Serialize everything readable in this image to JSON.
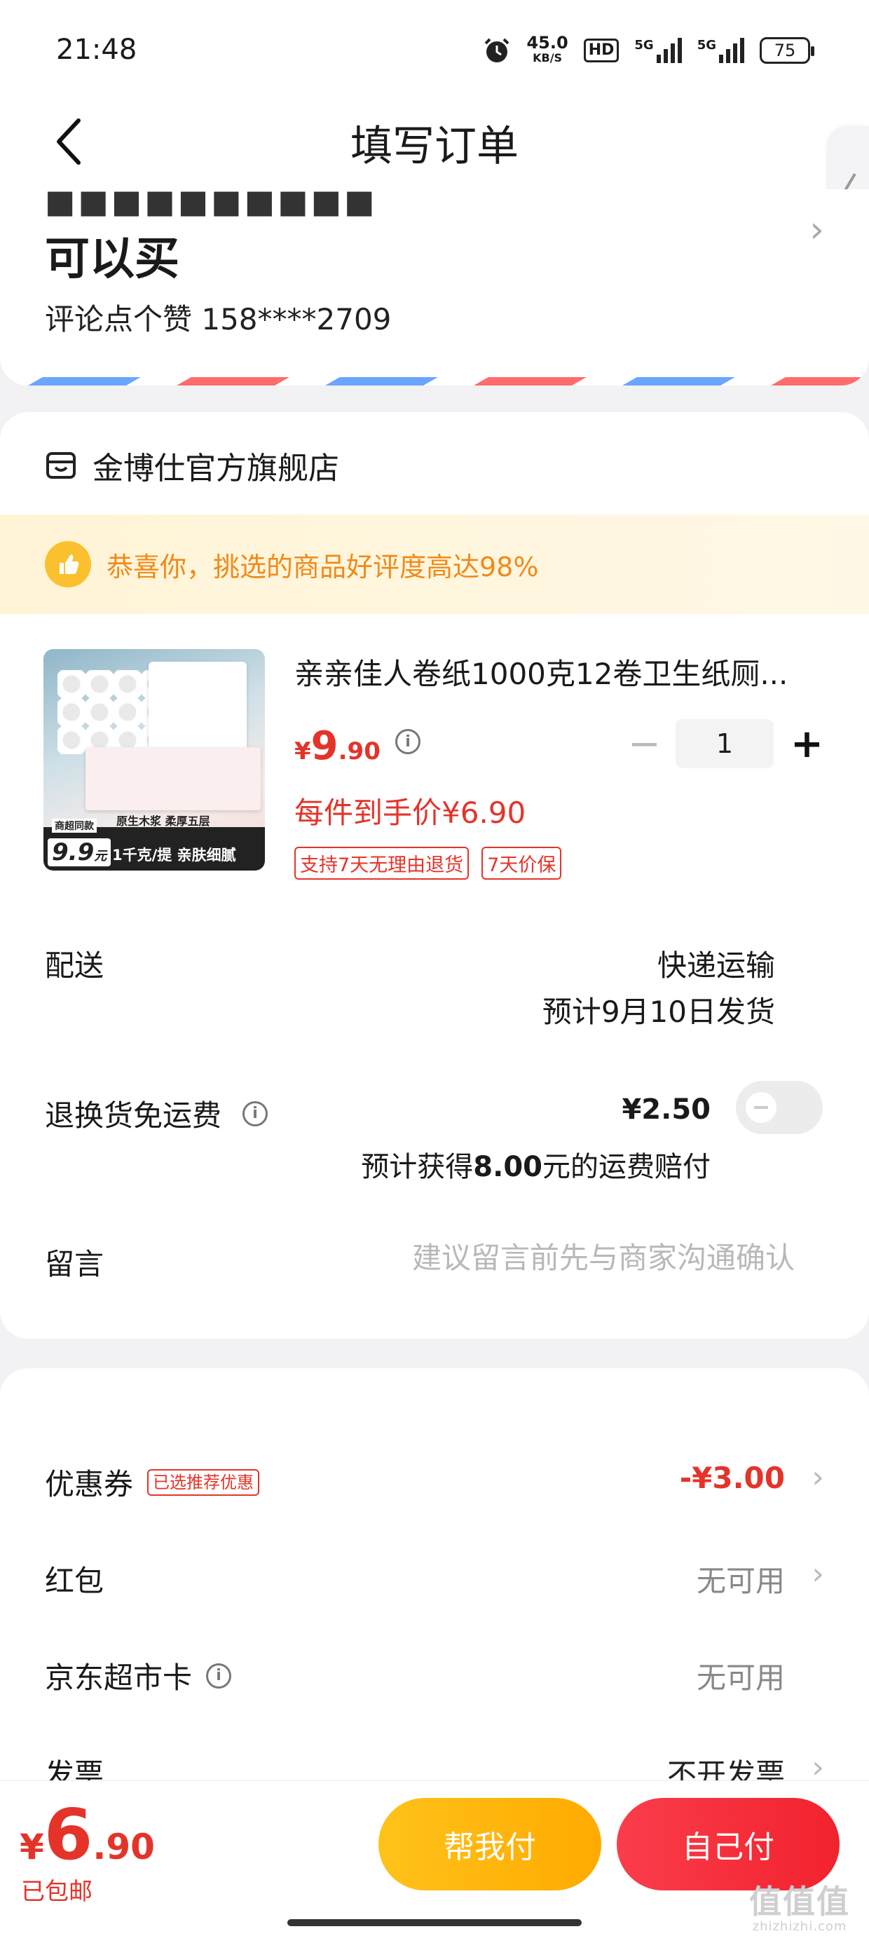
{
  "status_bar": {
    "time": "21:48",
    "net_speed": "45.0",
    "net_unit": "KB/S",
    "hd": "HD",
    "sim1": "5G",
    "sim2": "5G",
    "battery": "75"
  },
  "nav": {
    "title": "填写订单"
  },
  "address": {
    "partial_line": "■■■■■■■■■■",
    "main": "可以买",
    "contact": "评论点个赞  158****2709"
  },
  "store": {
    "name": "金博仕官方旗舰店",
    "banner_text": "恭喜你，挑选的商品好评度高达98%"
  },
  "product": {
    "title": "亲亲佳人卷纸1000克12卷卫生纸厕...",
    "price_symbol": "¥",
    "price_int": "9",
    "price_dec": ".90",
    "quantity": "1",
    "final_price": "每件到手价¥6.90",
    "tags": [
      "支持7天无理由退货",
      "7天价保"
    ],
    "image_price": "9.9",
    "image_price_unit": "元",
    "image_spec": "1千克/提  亲肤细腻",
    "image_spec_top": "原生木浆 柔厚五层",
    "image_tag": "商超同款"
  },
  "delivery": {
    "label": "配送",
    "method": "快递运输",
    "date": "预计9月10日发货"
  },
  "return_shipping": {
    "label": "退换货免运费",
    "price": "¥2.50",
    "compensation_pre": "预计获得",
    "compensation_amount": "8.00",
    "compensation_post": "元的运费赔付",
    "enabled": false
  },
  "message": {
    "label": "留言",
    "placeholder": "建议留言前先与商家沟通确认",
    "value": ""
  },
  "payment_rows": [
    {
      "label": "优惠券",
      "badge": "已选推荐优惠",
      "value": "-¥3.00"
    },
    {
      "label": "红包",
      "value": "无可用"
    },
    {
      "label": "京东超市卡",
      "value": "无可用"
    },
    {
      "label": "发票",
      "value": "不开发票"
    }
  ],
  "bottom": {
    "total_symbol": "¥",
    "total_int": "6",
    "total_dec": ".90",
    "free_shipping": "已包邮",
    "help_pay": "帮我付",
    "self_pay": "自己付"
  },
  "watermark": {
    "main": "值值值",
    "sub": "zhizhizhi.com"
  },
  "colors": {
    "accent_red": "#e4342a",
    "button_yellow": "#ffb20f",
    "button_red": "#f5303c",
    "banner_orange": "#f08a1a"
  }
}
